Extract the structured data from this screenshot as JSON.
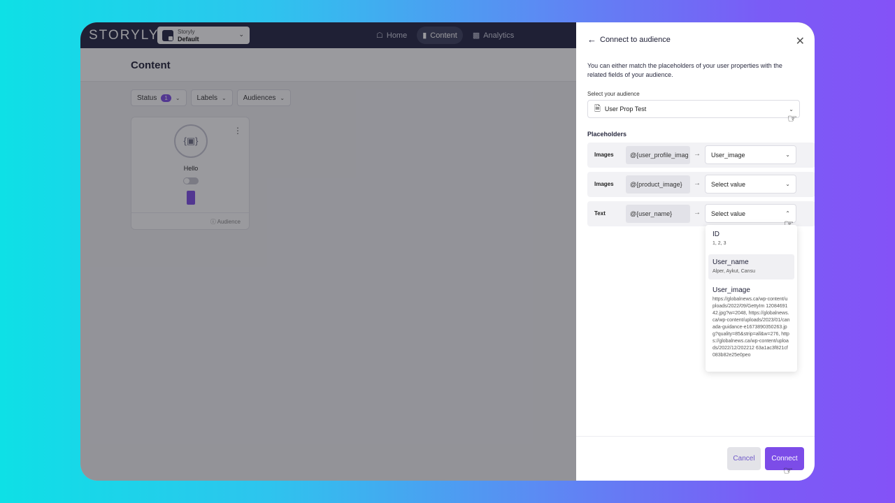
{
  "app": {
    "logo": "STORYLY",
    "app_select": {
      "line1": "Storyly",
      "line2": "Default"
    },
    "nav": [
      {
        "label": "Home",
        "icon": "home-icon"
      },
      {
        "label": "Content",
        "icon": "content-icon",
        "active": true
      },
      {
        "label": "Analytics",
        "icon": "analytics-icon"
      }
    ],
    "page_title": "Content",
    "filters": {
      "status": "Status",
      "status_count": "1",
      "labels": "Labels",
      "audiences": "Audiences"
    },
    "card": {
      "name": "Hello",
      "footer": "Audience"
    }
  },
  "drawer": {
    "title": "Connect to audience",
    "description": "You can either match the placeholders of your user properties with the related fields of your audience.",
    "audience_label": "Select your audience",
    "audience_value": "User Prop Test",
    "placeholders_title": "Placeholders",
    "rows": [
      {
        "type": "Images",
        "key": "@{user_profile_imag",
        "value": "User_image"
      },
      {
        "type": "Images",
        "key": "@{product_image}",
        "value": "Select value"
      },
      {
        "type": "Text",
        "key": "@{user_name}",
        "value": "Select value"
      }
    ],
    "options": [
      {
        "name": "ID",
        "sub": "1, 2, 3"
      },
      {
        "name": "User_name",
        "sub": "Alper, Aykut, Cansu"
      },
      {
        "name": "User_image",
        "sub": "https://globalnews.ca/wp-content/uploads/2022/09/GettyIm 1208469142.jpg?w=2048, https://globalnews.ca/wp-content/uploads/2023/01/canada-guidance-e1673890350263.jpg?quality=85&strip=all&w=276, https://globalnews.ca/wp-content/uploads/2022/12/202212 63a1ac3f821cf083b82e25e0peo"
      }
    ],
    "cancel": "Cancel",
    "connect": "Connect"
  },
  "colors": {
    "accent": "#7c4ce8",
    "nav_bg": "#1f2140"
  }
}
